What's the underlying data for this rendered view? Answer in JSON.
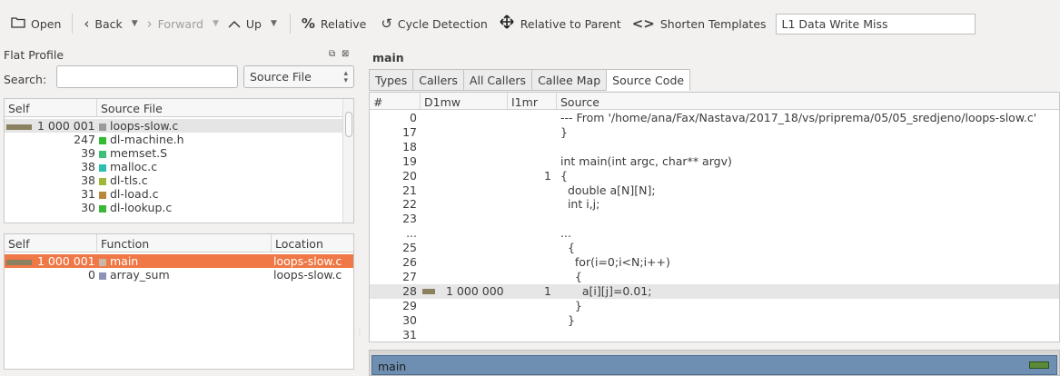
{
  "toolbar": {
    "open": "Open",
    "back": "Back",
    "forward": "Forward",
    "up": "Up",
    "relative": "Relative",
    "cycle_detection": "Cycle Detection",
    "relative_to_parent": "Relative to Parent",
    "shorten_templates": "Shorten Templates",
    "event_type": "L1 Data Write Miss",
    "icons": [
      "folder-icon",
      "chevron-left-icon",
      "chevron-right-icon",
      "chevron-up-icon",
      "percent-icon",
      "cycle-icon",
      "move-arrows-icon",
      "template-brackets-icon"
    ]
  },
  "flat_profile": {
    "title": "Flat Profile",
    "search_label": "Search:",
    "search_value": "",
    "group_by": "Source File",
    "files": {
      "headers": [
        "Self",
        "Source File"
      ],
      "rows": [
        {
          "self": "1 000 001",
          "name": "loops-slow.c",
          "color": "#9a9a9a",
          "bar": true
        },
        {
          "self": "247",
          "name": "dl-machine.h",
          "color": "#33bb33",
          "bar": false
        },
        {
          "self": "39",
          "name": "memset.S",
          "color": "#3cc07a",
          "bar": false
        },
        {
          "self": "38",
          "name": "malloc.c",
          "color": "#2bbfb0",
          "bar": false
        },
        {
          "self": "38",
          "name": "dl-tls.c",
          "color": "#a0b83a",
          "bar": false
        },
        {
          "self": "31",
          "name": "dl-load.c",
          "color": "#b8893a",
          "bar": false
        },
        {
          "self": "30",
          "name": "dl-lookup.c",
          "color": "#3ab83a",
          "bar": false
        }
      ]
    },
    "functions": {
      "headers": [
        "Self",
        "Function",
        "Location"
      ],
      "rows": [
        {
          "self": "1 000 001",
          "name": "main",
          "location": "loops-slow.c",
          "color": "#c9b8a8",
          "bar": true
        },
        {
          "self": "0",
          "name": "array_sum",
          "location": "loops-slow.c",
          "color": "#8c93b5",
          "bar": false
        }
      ]
    }
  },
  "detail": {
    "title": "main",
    "tabs": [
      "Types",
      "Callers",
      "All Callers",
      "Callee Map",
      "Source Code"
    ],
    "active_tab": "Source Code",
    "source": {
      "headers": [
        "#",
        "D1mw",
        "I1mr",
        "Source"
      ],
      "rows": [
        {
          "line": "0",
          "d1mw": "",
          "i1mr": "",
          "code": "--- From '/home/ana/Fax/Nastava/2017_18/vs/priprema/05/05_sredjeno/loops-slow.c'",
          "bar": false
        },
        {
          "line": "17",
          "d1mw": "",
          "i1mr": "",
          "code": "}",
          "bar": false
        },
        {
          "line": "18",
          "d1mw": "",
          "i1mr": "",
          "code": "",
          "bar": false
        },
        {
          "line": "19",
          "d1mw": "",
          "i1mr": "",
          "code": "int main(int argc, char** argv)",
          "bar": false
        },
        {
          "line": "20",
          "d1mw": "",
          "i1mr": "1",
          "code": "{",
          "bar": false
        },
        {
          "line": "21",
          "d1mw": "",
          "i1mr": "",
          "code": "  double a[N][N];",
          "bar": false
        },
        {
          "line": "22",
          "d1mw": "",
          "i1mr": "",
          "code": "  int i,j;",
          "bar": false
        },
        {
          "line": "23",
          "d1mw": "",
          "i1mr": "",
          "code": "",
          "bar": false
        },
        {
          "line": "...",
          "d1mw": "",
          "i1mr": "",
          "code": "...",
          "bar": false
        },
        {
          "line": "25",
          "d1mw": "",
          "i1mr": "",
          "code": "  {",
          "bar": false
        },
        {
          "line": "26",
          "d1mw": "",
          "i1mr": "",
          "code": "    for(i=0;i<N;i++)",
          "bar": false
        },
        {
          "line": "27",
          "d1mw": "",
          "i1mr": "",
          "code": "    {",
          "bar": false
        },
        {
          "line": "28",
          "d1mw": "1 000 000",
          "i1mr": "1",
          "code": "      a[i][j]=0.01;",
          "bar": true
        },
        {
          "line": "29",
          "d1mw": "",
          "i1mr": "",
          "code": "    }",
          "bar": false
        },
        {
          "line": "30",
          "d1mw": "",
          "i1mr": "",
          "code": "  }",
          "bar": false
        },
        {
          "line": "31",
          "d1mw": "",
          "i1mr": "",
          "code": "",
          "bar": false
        }
      ]
    }
  },
  "call_graph": {
    "label": "main"
  }
}
